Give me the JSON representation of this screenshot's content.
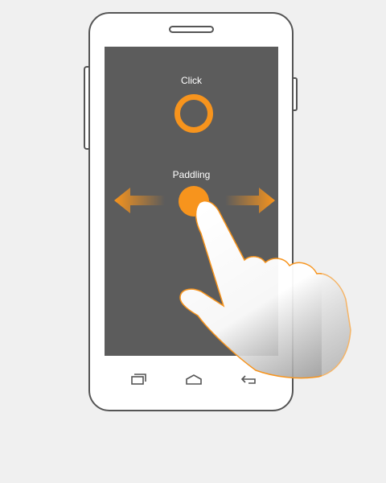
{
  "screen": {
    "click_label": "Click",
    "paddling_label": "Paddling"
  },
  "colors": {
    "accent": "#f7941d",
    "screen_bg": "#5c5c5c",
    "device_outline": "#555555",
    "background": "#f0f0f0"
  },
  "icons": {
    "gesture_click": "ring-icon",
    "gesture_drag": "dot-icon",
    "arrow_left": "arrow-left-icon",
    "arrow_right": "arrow-right-icon",
    "nav_recent": "recent-apps-icon",
    "nav_home": "home-icon",
    "nav_back": "back-icon",
    "hand": "pointing-hand-icon"
  }
}
